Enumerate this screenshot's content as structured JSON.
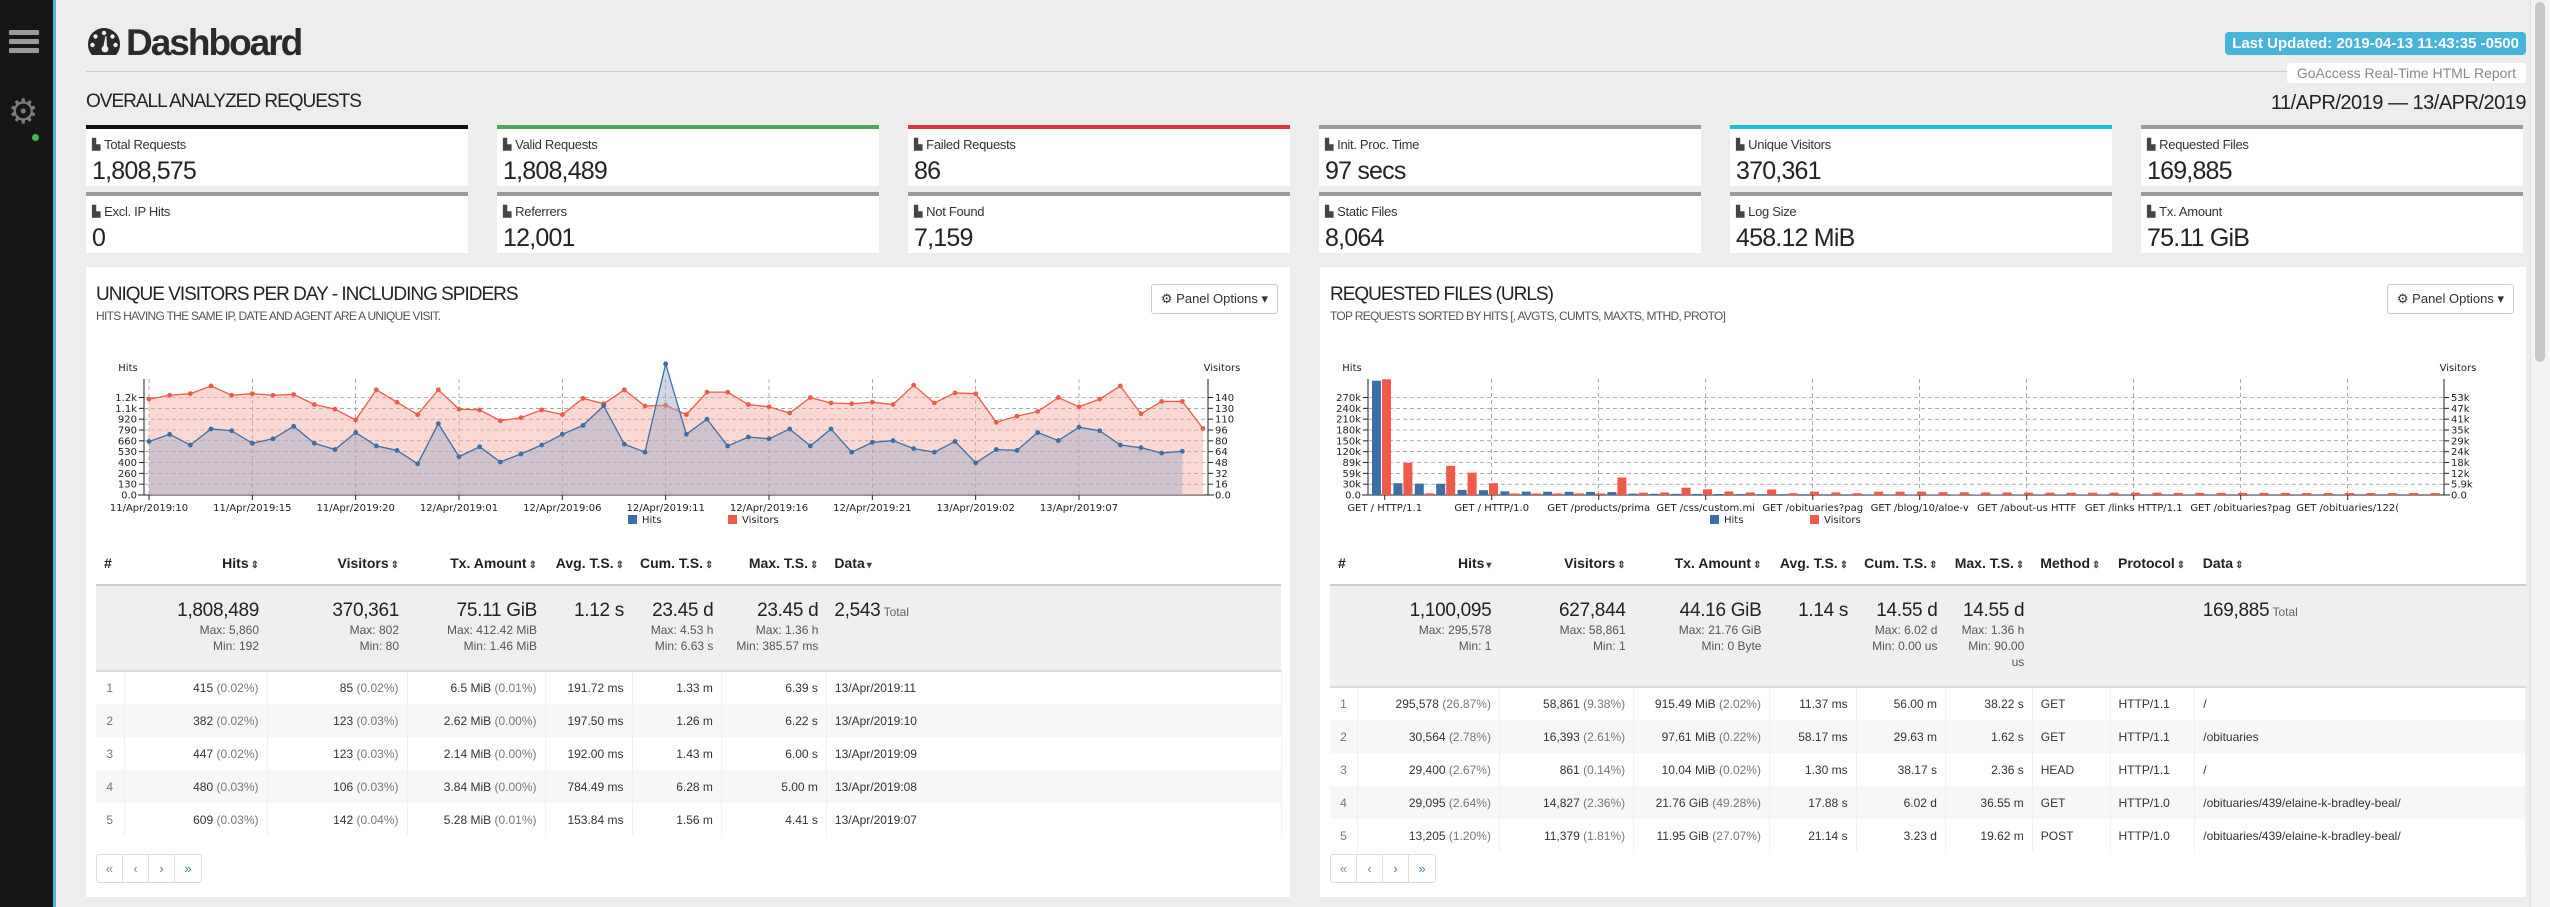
{
  "header": {
    "title": "Dashboard",
    "last_updated": "Last Updated: 2019-04-13 11:43:35 -0500",
    "report_label": "GoAccess Real-Time HTML Report",
    "overall_title": "OVERALL ANALYZED REQUESTS",
    "date_range": "11/APR/2019 — 13/APR/2019"
  },
  "cards": [
    {
      "label": "Total Requests",
      "value": "1,808,575",
      "accent": "#111111"
    },
    {
      "label": "Valid Requests",
      "value": "1,808,489",
      "accent": "#4ea45a"
    },
    {
      "label": "Failed Requests",
      "value": "86",
      "accent": "#d9363e"
    },
    {
      "label": "Init. Proc. Time",
      "value": "97 secs",
      "accent": "#999999"
    },
    {
      "label": "Unique Visitors",
      "value": "370,361",
      "accent": "#1fbfd0"
    },
    {
      "label": "Requested Files",
      "value": "169,885",
      "accent": "#999999"
    },
    {
      "label": "Excl. IP Hits",
      "value": "0",
      "accent": "#999999"
    },
    {
      "label": "Referrers",
      "value": "12,001",
      "accent": "#999999"
    },
    {
      "label": "Not Found",
      "value": "7,159",
      "accent": "#999999"
    },
    {
      "label": "Static Files",
      "value": "8,064",
      "accent": "#999999"
    },
    {
      "label": "Log Size",
      "value": "458.12 MiB",
      "accent": "#999999"
    },
    {
      "label": "Tx. Amount",
      "value": "75.11 GiB",
      "accent": "#999999"
    }
  ],
  "colors": {
    "hits": "#3d6ea5",
    "visitors": "#f15a4a"
  },
  "panels": {
    "visitors": {
      "title": "UNIQUE VISITORS PER DAY - INCLUDING SPIDERS",
      "subtitle": "HITS HAVING THE SAME IP, DATE AND AGENT ARE A UNIQUE VISIT.",
      "options_label": "Panel Options",
      "columns": [
        {
          "label": "#",
          "sort": ""
        },
        {
          "label": "Hits",
          "sort": "⇕"
        },
        {
          "label": "Visitors",
          "sort": "⇕"
        },
        {
          "label": "Tx. Amount",
          "sort": "⇕"
        },
        {
          "label": "Avg. T.S.",
          "sort": "⇕"
        },
        {
          "label": "Cum. T.S.",
          "sort": "⇕"
        },
        {
          "label": "Max. T.S.",
          "sort": "⇕"
        },
        {
          "label": "Data",
          "sort": "▾"
        }
      ],
      "totals": {
        "hits": {
          "value": "1,808,489",
          "max": "Max: 5,860",
          "min": "Min: 192"
        },
        "visitors": {
          "value": "370,361",
          "max": "Max: 802",
          "min": "Min: 80"
        },
        "tx": {
          "value": "75.11 GiB",
          "max": "Max: 412.42 MiB",
          "min": "Min: 1.46 MiB"
        },
        "avg": {
          "value": "1.12 s"
        },
        "cum": {
          "value": "23.45 d",
          "max": "Max: 4.53 h",
          "min": "Min: 6.63 s"
        },
        "maxts": {
          "value": "23.45 d",
          "max": "Max: 1.36 h",
          "min": "Min: 385.57 ms"
        },
        "data": {
          "value": "2,543",
          "suffix": "Total"
        }
      },
      "rows": [
        {
          "idx": "1",
          "hits": "415",
          "hits_pct": "(0.02%)",
          "visitors": "85",
          "visitors_pct": "(0.02%)",
          "tx": "6.5 MiB",
          "tx_pct": "(0.01%)",
          "avg": "191.72 ms",
          "cum": "1.33 m",
          "max": "6.39 s",
          "data": "13/Apr/2019:11"
        },
        {
          "idx": "2",
          "hits": "382",
          "hits_pct": "(0.02%)",
          "visitors": "123",
          "visitors_pct": "(0.03%)",
          "tx": "2.62 MiB",
          "tx_pct": "(0.00%)",
          "avg": "197.50 ms",
          "cum": "1.26 m",
          "max": "6.22 s",
          "data": "13/Apr/2019:10"
        },
        {
          "idx": "3",
          "hits": "447",
          "hits_pct": "(0.02%)",
          "visitors": "123",
          "visitors_pct": "(0.03%)",
          "tx": "2.14 MiB",
          "tx_pct": "(0.00%)",
          "avg": "192.00 ms",
          "cum": "1.43 m",
          "max": "6.00 s",
          "data": "13/Apr/2019:09"
        },
        {
          "idx": "4",
          "hits": "480",
          "hits_pct": "(0.03%)",
          "visitors": "106",
          "visitors_pct": "(0.03%)",
          "tx": "3.84 MiB",
          "tx_pct": "(0.00%)",
          "avg": "784.49 ms",
          "cum": "6.28 m",
          "max": "5.00 m",
          "data": "13/Apr/2019:08"
        },
        {
          "idx": "5",
          "hits": "609",
          "hits_pct": "(0.03%)",
          "visitors": "142",
          "visitors_pct": "(0.04%)",
          "tx": "5.28 MiB",
          "tx_pct": "(0.01%)",
          "avg": "153.84 ms",
          "cum": "1.56 m",
          "max": "4.41 s",
          "data": "13/Apr/2019:07"
        }
      ],
      "pager": [
        "«",
        "‹",
        "›",
        "»"
      ]
    },
    "requests": {
      "title": "REQUESTED FILES (URLS)",
      "subtitle": "TOP REQUESTS SORTED BY HITS [, AVGTS, CUMTS, MAXTS, MTHD, PROTO]",
      "options_label": "Panel Options",
      "columns": [
        {
          "label": "#",
          "sort": ""
        },
        {
          "label": "Hits",
          "sort": "▾"
        },
        {
          "label": "Visitors",
          "sort": "⇕"
        },
        {
          "label": "Tx. Amount",
          "sort": "⇕"
        },
        {
          "label": "Avg. T.S.",
          "sort": "⇕"
        },
        {
          "label": "Cum. T.S.",
          "sort": "⇕"
        },
        {
          "label": "Max. T.S.",
          "sort": "⇕"
        },
        {
          "label": "Method",
          "sort": "⇕"
        },
        {
          "label": "Protocol",
          "sort": "⇕"
        },
        {
          "label": "Data",
          "sort": "⇕"
        }
      ],
      "totals": {
        "hits": {
          "value": "1,100,095",
          "max": "Max: 295,578",
          "min": "Min: 1"
        },
        "visitors": {
          "value": "627,844",
          "max": "Max: 58,861",
          "min": "Min: 1"
        },
        "tx": {
          "value": "44.16 GiB",
          "max": "Max: 21.76 GiB",
          "min": "Min: 0 Byte"
        },
        "avg": {
          "value": "1.14 s"
        },
        "cum": {
          "value": "14.55 d",
          "max": "Max: 6.02 d",
          "min": "Min: 0.00 us"
        },
        "maxts": {
          "value": "14.55 d",
          "max": "Max: 1.36 h",
          "min": "Min: 90.00 us"
        },
        "data": {
          "value": "169,885",
          "suffix": "Total"
        }
      },
      "rows": [
        {
          "idx": "1",
          "hits": "295,578",
          "hits_pct": "(26.87%)",
          "visitors": "58,861",
          "visitors_pct": "(9.38%)",
          "tx": "915.49 MiB",
          "tx_pct": "(2.02%)",
          "avg": "11.37 ms",
          "cum": "56.00 m",
          "max": "38.22 s",
          "method": "GET",
          "protocol": "HTTP/1.1",
          "data": "/"
        },
        {
          "idx": "2",
          "hits": "30,564",
          "hits_pct": "(2.78%)",
          "visitors": "16,393",
          "visitors_pct": "(2.61%)",
          "tx": "97.61 MiB",
          "tx_pct": "(0.22%)",
          "avg": "58.17 ms",
          "cum": "29.63 m",
          "max": "1.62 s",
          "method": "GET",
          "protocol": "HTTP/1.1",
          "data": "/obituaries"
        },
        {
          "idx": "3",
          "hits": "29,400",
          "hits_pct": "(2.67%)",
          "visitors": "861",
          "visitors_pct": "(0.14%)",
          "tx": "10.04 MiB",
          "tx_pct": "(0.02%)",
          "avg": "1.30 ms",
          "cum": "38.17 s",
          "max": "2.36 s",
          "method": "HEAD",
          "protocol": "HTTP/1.1",
          "data": "/"
        },
        {
          "idx": "4",
          "hits": "29,095",
          "hits_pct": "(2.64%)",
          "visitors": "14,827",
          "visitors_pct": "(2.36%)",
          "tx": "21.76 GiB",
          "tx_pct": "(49.28%)",
          "avg": "17.88 s",
          "cum": "6.02 d",
          "max": "36.55 m",
          "method": "GET",
          "protocol": "HTTP/1.0",
          "data": "/obituaries/439/elaine-k-bradley-beal/"
        },
        {
          "idx": "5",
          "hits": "13,205",
          "hits_pct": "(1.20%)",
          "visitors": "11,379",
          "visitors_pct": "(1.81%)",
          "tx": "11.95 GiB",
          "tx_pct": "(27.07%)",
          "avg": "21.14 s",
          "cum": "3.23 d",
          "max": "19.62 m",
          "method": "POST",
          "protocol": "HTTP/1.0",
          "data": "/obituaries/439/elaine-k-bradley-beal/"
        }
      ],
      "pager": [
        "«",
        "‹",
        "›",
        "»"
      ]
    }
  },
  "chart_data": [
    {
      "type": "area",
      "title": "UNIQUE VISITORS PER DAY - INCLUDING SPIDERS",
      "ylabel": "Hits",
      "y2label": "Visitors",
      "ylim": [
        0,
        1300
      ],
      "y2lim": [
        0,
        150
      ],
      "yticks": [
        "0.0",
        "130",
        "260",
        "400",
        "530",
        "660",
        "790",
        "920",
        "1.1k",
        "1.2k"
      ],
      "y2ticks": [
        "0.0",
        "16",
        "32",
        "48",
        "64",
        "80",
        "96",
        "110",
        "130",
        "140"
      ],
      "xticks": [
        "11/Apr/2019:10",
        "11/Apr/2019:15",
        "11/Apr/2019:20",
        "12/Apr/2019:01",
        "12/Apr/2019:06",
        "12/Apr/2019:11",
        "12/Apr/2019:16",
        "12/Apr/2019:21",
        "13/Apr/2019:02",
        "13/Apr/2019:07"
      ],
      "legend": [
        "Hits",
        "Visitors"
      ],
      "legend_position": "bottom",
      "grid": true,
      "series": [
        {
          "name": "Hits",
          "axis": "left",
          "values": [
            600,
            680,
            560,
            740,
            720,
            580,
            630,
            770,
            580,
            510,
            700,
            550,
            500,
            350,
            800,
            430,
            540,
            370,
            460,
            560,
            680,
            780,
            1000,
            570,
            480,
            1470,
            680,
            850,
            550,
            650,
            630,
            740,
            550,
            740,
            480,
            590,
            610,
            520,
            480,
            600,
            360,
            510,
            500,
            700,
            610,
            760,
            720,
            560,
            530,
            470,
            490
          ]
        },
        {
          "name": "Visitors",
          "axis": "right",
          "values": [
            124,
            129,
            131,
            141,
            129,
            131,
            129,
            130,
            117,
            111,
            97,
            136,
            120,
            104,
            136,
            111,
            110,
            96,
            100,
            110,
            104,
            125,
            118,
            136,
            115,
            116,
            104,
            133,
            133,
            117,
            114,
            106,
            126,
            119,
            118,
            120,
            117,
            142,
            119,
            132,
            131,
            94,
            102,
            108,
            126,
            114,
            124,
            141,
            105,
            121,
            121,
            86
          ]
        }
      ]
    },
    {
      "type": "bar",
      "title": "REQUESTED FILES (URLS)",
      "ylabel": "Hits",
      "y2label": "Visitors",
      "ylim": [
        0,
        300000
      ],
      "y2lim": [
        0,
        59000
      ],
      "yticks": [
        "0.0",
        "30k",
        "59k",
        "89k",
        "120k",
        "150k",
        "180k",
        "210k",
        "240k",
        "270k"
      ],
      "y2ticks": [
        "0.0",
        "5.9k",
        "12k",
        "18k",
        "24k",
        "29k",
        "35k",
        "41k",
        "47k",
        "53k"
      ],
      "xticks": [
        "GET / HTTP/1.1",
        "GET / HTTP/1.0",
        "GET /products/prima",
        "GET /css/custom.mi",
        "GET /obituaries?pag",
        "GET /blog/10/aloe-v",
        "GET /about-us HTTF",
        "GET /links HTTP/1.1",
        "GET /obituaries?pag",
        "GET /obituaries/122("
      ],
      "legend": [
        "Hits",
        "Visitors"
      ],
      "legend_position": "bottom",
      "grid": true,
      "series": [
        {
          "name": "Hits",
          "axis": "left",
          "values": [
            295578,
            30564,
            29400,
            29095,
            13205,
            12500,
            9500,
            8800,
            8500,
            8200,
            7900,
            7600,
            3500,
            3200,
            3000,
            2800,
            2600,
            2400,
            2200,
            2100,
            2000,
            1900,
            1800,
            1700,
            1600,
            1500,
            1400,
            1300,
            1200,
            1100,
            1000,
            950,
            900,
            850,
            800,
            750,
            700,
            650,
            600,
            550,
            500,
            450,
            400,
            380,
            360,
            340,
            320,
            300,
            280,
            260
          ]
        },
        {
          "name": "Visitors",
          "axis": "right",
          "values": [
            58861,
            16393,
            861,
            14827,
            11379,
            6000,
            800,
            800,
            800,
            800,
            800,
            8900,
            1200,
            1300,
            3700,
            2900,
            1800,
            1300,
            2800,
            900,
            1700,
            1300,
            900,
            1700,
            1700,
            1700,
            1400,
            1400,
            1300,
            1300,
            1200,
            1200,
            1200,
            1200,
            1200,
            1200,
            1200,
            1100,
            1100,
            1100,
            1100,
            1100,
            1100,
            1000,
            1000,
            1000,
            1000,
            1000,
            1000,
            1000
          ]
        }
      ]
    }
  ]
}
